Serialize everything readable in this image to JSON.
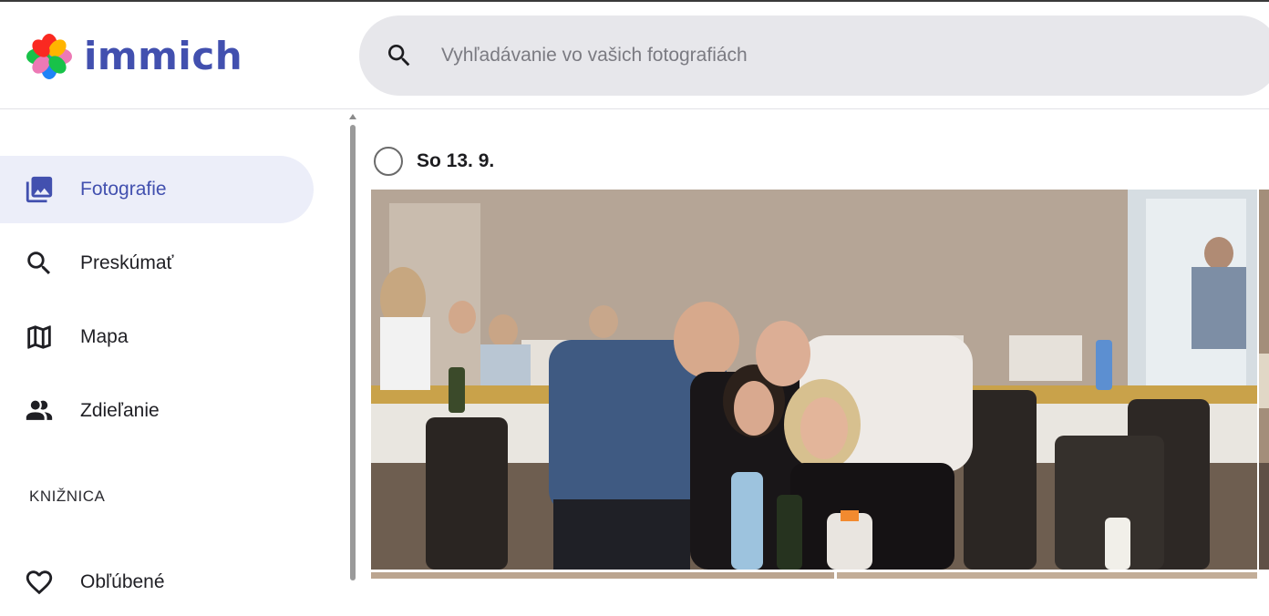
{
  "app": {
    "logo_text": "immich"
  },
  "search": {
    "placeholder": "Vyhľadávanie vo vašich fotografiách"
  },
  "sidebar": {
    "items": [
      {
        "label": "Fotografie",
        "icon": "image-multiple-icon",
        "active": true
      },
      {
        "label": "Preskúmať",
        "icon": "magnify-icon"
      },
      {
        "label": "Mapa",
        "icon": "map-outline-icon"
      },
      {
        "label": "Zdieľanie",
        "icon": "account-multiple-icon"
      }
    ],
    "section_label": "KNIŽNICA",
    "partial_item": {
      "label": "Obľúbené",
      "icon": "heart-outline-icon"
    }
  },
  "timeline": {
    "date_label": "So 13. 9."
  },
  "colors": {
    "accent": "#4250af",
    "active_bg": "#eceef9",
    "search_bg": "#e7e7eb"
  }
}
